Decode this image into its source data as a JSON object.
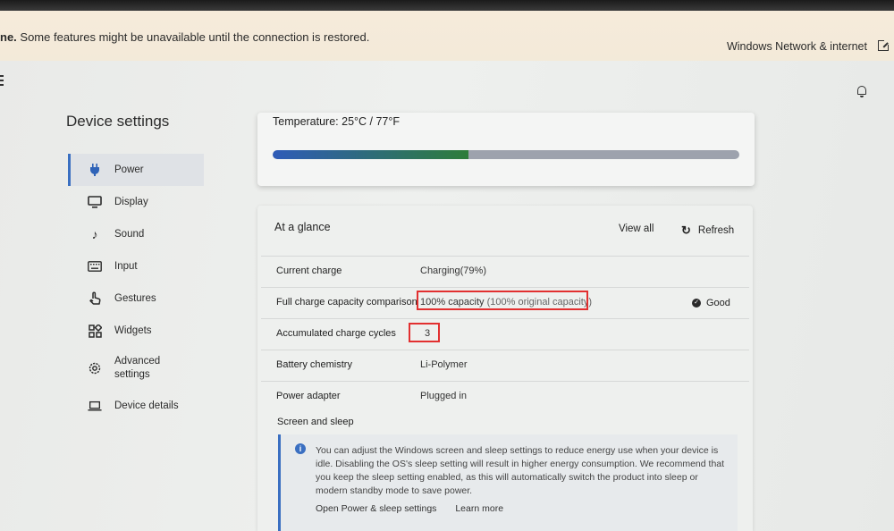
{
  "banner": {
    "message_bold": "ne.",
    "message": " Some features might be unavailable until the connection is restored.",
    "link": "Windows Network & internet"
  },
  "sidebar": {
    "title": "Device settings",
    "items": [
      {
        "label": "Power",
        "icon": "plug-icon",
        "active": true
      },
      {
        "label": "Display",
        "icon": "monitor-icon"
      },
      {
        "label": "Sound",
        "icon": "music-note-icon"
      },
      {
        "label": "Input",
        "icon": "keyboard-icon"
      },
      {
        "label": "Gestures",
        "icon": "hand-icon"
      },
      {
        "label": "Widgets",
        "icon": "widgets-icon"
      },
      {
        "label": "Advanced settings",
        "icon": "advanced-gear-icon"
      },
      {
        "label": "Device details",
        "icon": "laptop-icon"
      }
    ]
  },
  "temperature": {
    "label": "Temperature:  25°C / 77°F",
    "bar_fill_fraction": 0.42,
    "colors": {
      "fill_start": "#2f5bb8",
      "fill_end": "#2e7d3a",
      "track": "#9da2ad"
    }
  },
  "glance": {
    "title": "At a glance",
    "view_all": "View all",
    "refresh": "Refresh",
    "rows": [
      {
        "key": "Current charge",
        "value": "Charging(79%)"
      },
      {
        "key": "Full charge capacity comparison",
        "value": "100% capacity",
        "value_muted": "(100% original capacity)",
        "status": "Good"
      },
      {
        "key": "Accumulated charge cycles",
        "value": "3"
      },
      {
        "key": "Battery chemistry",
        "value": "Li-Polymer"
      },
      {
        "key": "Power adapter",
        "value": "Plugged in"
      }
    ],
    "section_title": "Screen and sleep",
    "info_text": "You can adjust the Windows screen and sleep settings to reduce energy use when your device is idle. Disabling the OS's sleep setting will result in higher energy consumption. We recommend that you keep the sleep setting enabled, as this will automatically switch the product into sleep or modern standby mode to save power.",
    "links": [
      "Open Power & sleep settings",
      "Learn more"
    ]
  },
  "colors": {
    "accent": "#3a6fc1",
    "highlight_box": "#e23030",
    "banner_bg": "#f3ead9"
  }
}
